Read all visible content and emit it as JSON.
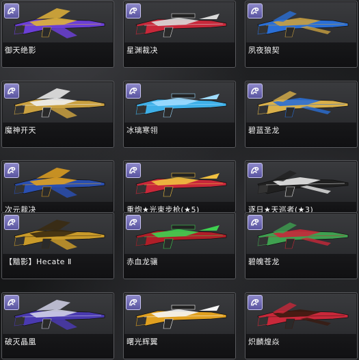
{
  "items": [
    {
      "name": "御天绝影",
      "colors": [
        "#6b3fd6",
        "#e0b23a"
      ]
    },
    {
      "name": "星渊裁决",
      "colors": [
        "#c8283a",
        "#d9d9d9"
      ]
    },
    {
      "name": "夙夜狼契",
      "colors": [
        "#2a6fd6",
        "#c9a040"
      ]
    },
    {
      "name": "魔神开天",
      "colors": [
        "#c9a040",
        "#f0f0f0"
      ]
    },
    {
      "name": "冰璃寒翎",
      "colors": [
        "#3fb0e8",
        "#9fdcff"
      ]
    },
    {
      "name": "碧蓝圣龙",
      "colors": [
        "#d9b04a",
        "#2a6fd6"
      ]
    },
    {
      "name": "次元裁决",
      "colors": [
        "#2a4fb0",
        "#e0a020"
      ]
    },
    {
      "name": "重炮★光束步枪(★5)",
      "colors": [
        "#c8283a",
        "#f0c040"
      ]
    },
    {
      "name": "逐日★天巡者(★3)",
      "colors": [
        "#202020",
        "#e8e8e8"
      ]
    },
    {
      "name": "【黯影】Hecate Ⅱ",
      "colors": [
        "#c99a2a",
        "#3a2a10"
      ]
    },
    {
      "name": "赤血龙骧",
      "colors": [
        "#b01e28",
        "#3fd050"
      ]
    },
    {
      "name": "碧魄苍龙",
      "colors": [
        "#3fa050",
        "#c8283a"
      ]
    },
    {
      "name": "破灭晶凰",
      "colors": [
        "#4a3ab0",
        "#d0d0e8"
      ]
    },
    {
      "name": "曙光辉翼",
      "colors": [
        "#e0a020",
        "#f5f5f5"
      ]
    },
    {
      "name": "炽麟煌焱",
      "colors": [
        "#c8283a",
        "#3a1a10"
      ]
    }
  ],
  "badge_icon": "weapon-class-icon"
}
